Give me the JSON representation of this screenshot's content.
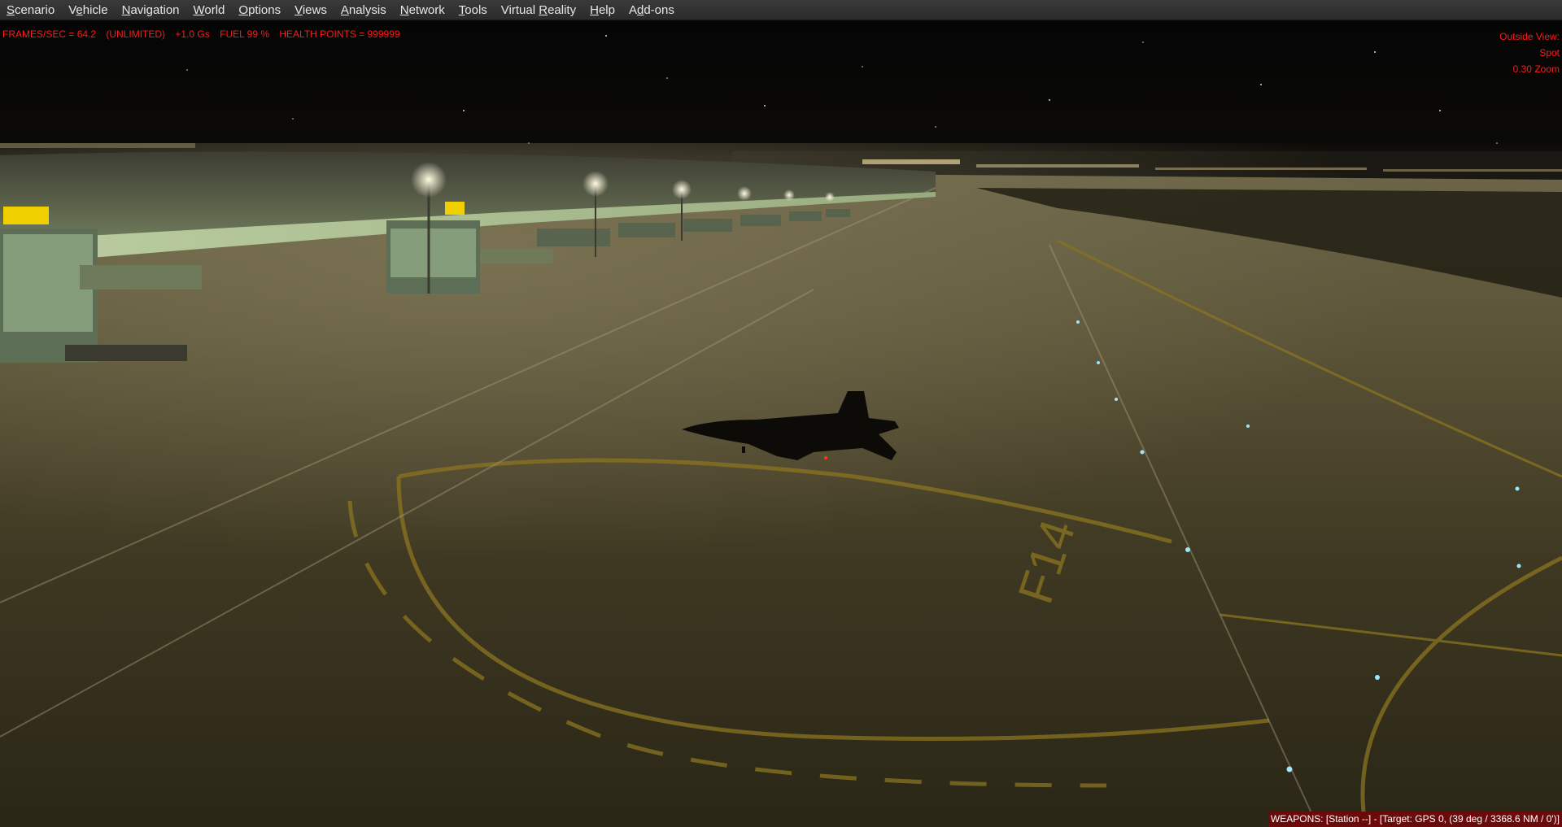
{
  "menu": [
    {
      "pre": "",
      "mn": "S",
      "post": "cenario"
    },
    {
      "pre": "V",
      "mn": "e",
      "post": "hicle"
    },
    {
      "pre": "",
      "mn": "N",
      "post": "avigation"
    },
    {
      "pre": "",
      "mn": "W",
      "post": "orld"
    },
    {
      "pre": "",
      "mn": "O",
      "post": "ptions"
    },
    {
      "pre": "",
      "mn": "V",
      "post": "iews"
    },
    {
      "pre": "",
      "mn": "A",
      "post": "nalysis"
    },
    {
      "pre": "",
      "mn": "N",
      "post": "etwork"
    },
    {
      "pre": "",
      "mn": "T",
      "post": "ools"
    },
    {
      "pre": "Virtual ",
      "mn": "R",
      "post": "eality"
    },
    {
      "pre": "",
      "mn": "H",
      "post": "elp"
    },
    {
      "pre": "A",
      "mn": "d",
      "post": "d-ons"
    }
  ],
  "hud": {
    "fps": "FRAMES/SEC = 64.2",
    "limit": "(UNLIMITED)",
    "gforce": "+1.0 Gs",
    "fuel": "FUEL 99 %",
    "health": "HEALTH POINTS = 999999",
    "view_mode": "Outside View:",
    "view_type": "Spot",
    "zoom": "0.30 Zoom",
    "hud_color": "#ff1a1a"
  },
  "scene": {
    "taxiway_marking": "F14",
    "aircraft_icon": "fighter-jet-silhouette"
  },
  "weapons": "WEAPONS: [Station --] - [Target: GPS 0, (39 deg / 3368.6 NM / 0')]",
  "colors": {
    "menubar": "#2f2f2f",
    "weapons_bg": "#6b0a0a",
    "taxi_line": "#8a7420"
  }
}
